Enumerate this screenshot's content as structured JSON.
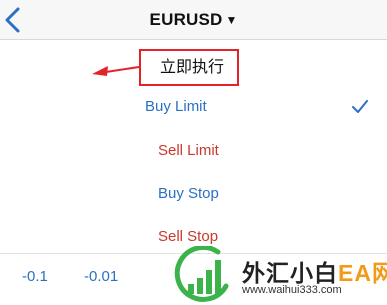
{
  "nav": {
    "back_icon": "chevron-left-icon",
    "title": "EURUSD",
    "caret": "▼"
  },
  "order_types": [
    {
      "label": "立即执行",
      "color": "#111111",
      "highlighted": true
    },
    {
      "label": "Buy Limit",
      "color": "#2a70c4",
      "selected": true
    },
    {
      "label": "Sell Limit",
      "color": "#c8382e"
    },
    {
      "label": "Buy Stop",
      "color": "#2a70c4"
    },
    {
      "label": "Sell Stop",
      "color": "#c8382e"
    }
  ],
  "selected_icon": "checkmark-icon",
  "annotation": {
    "color": "#e2242a",
    "arrow_icon": "red-arrow-icon"
  },
  "bottom_bar": {
    "steps": [
      "-0.1",
      "-0.01"
    ]
  },
  "watermark": {
    "text_main": "外汇小白",
    "text_ea": "EA网",
    "url": "www.waihui333.com",
    "logo_icon": "signal-bars-logo-icon"
  },
  "colors": {
    "accent_blue": "#2a70c4",
    "sell_red": "#c8382e",
    "annotation_red": "#e2242a",
    "watermark_green": "#3bb34a",
    "watermark_orange": "#f39a17"
  }
}
